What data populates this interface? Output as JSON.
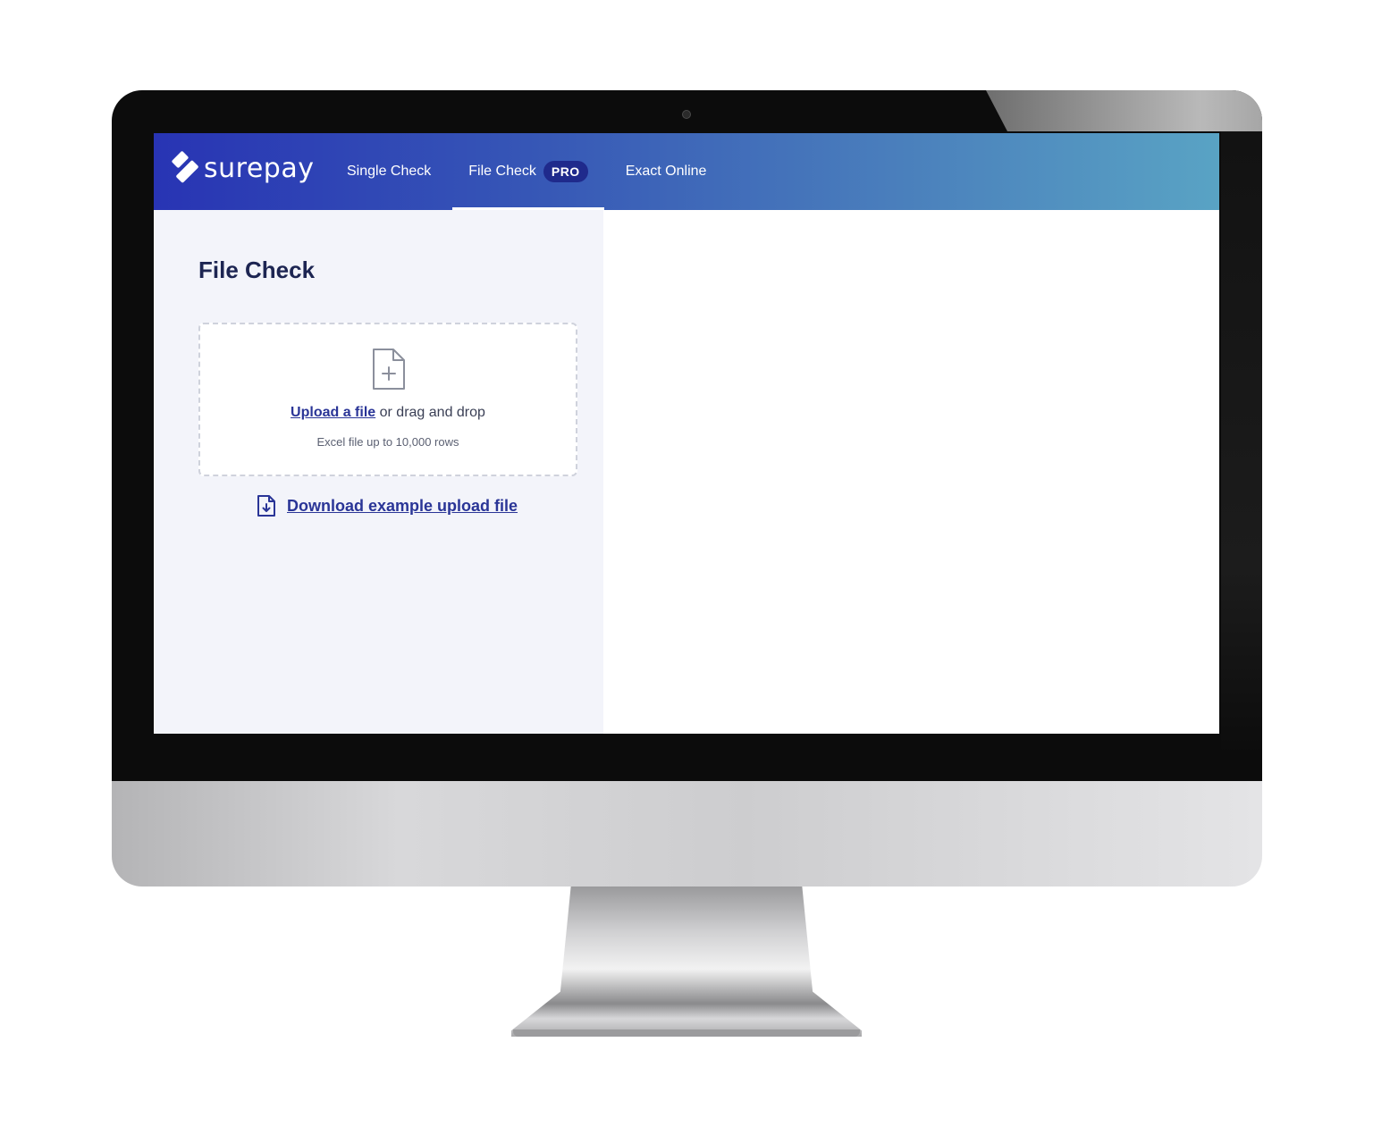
{
  "app": {
    "brand": "surepay"
  },
  "nav": {
    "items": [
      {
        "label": "Single Check",
        "active": false
      },
      {
        "label": "File Check",
        "active": true,
        "badge": "PRO"
      },
      {
        "label": "Exact Online",
        "active": false
      }
    ]
  },
  "main": {
    "title": "File Check",
    "dropzone": {
      "link_label": "Upload a file",
      "text": "or drag and drop",
      "hint": "Excel file up to 10,000 rows"
    },
    "download_label": "Download example upload file"
  },
  "icons": {
    "logo": "surepay-logo-icon",
    "file_add": "file-plus-icon",
    "download_file": "file-download-icon"
  },
  "colors": {
    "header_start": "#2834b4",
    "header_end": "#59a3c4",
    "badge": "#1f2a8c",
    "link": "#2a3597",
    "title": "#1d2552",
    "panel_bg": "#f3f4fa"
  }
}
